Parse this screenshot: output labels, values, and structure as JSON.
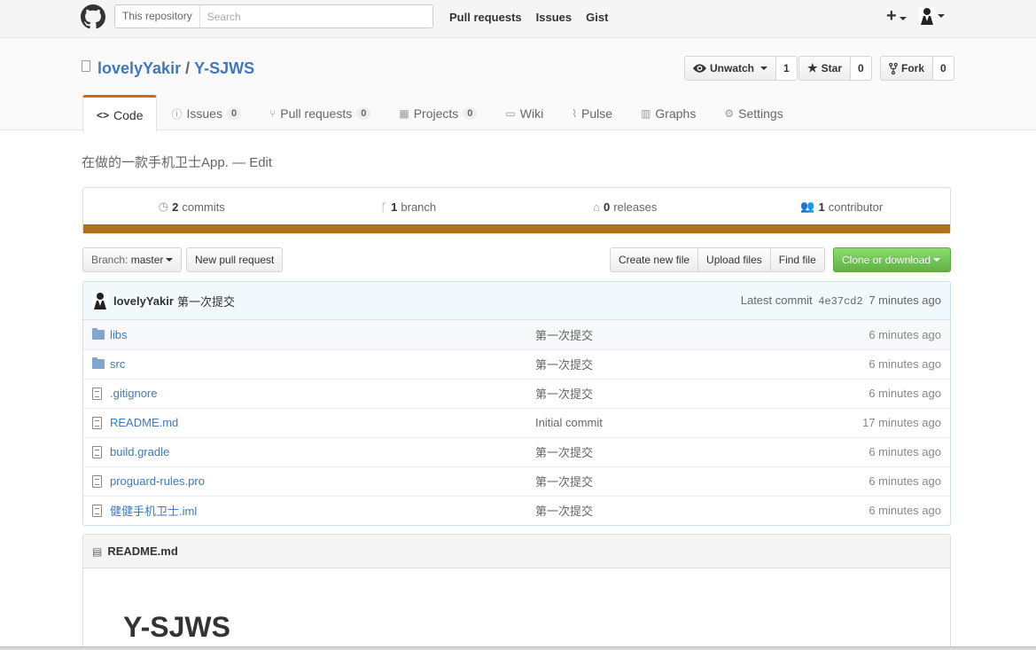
{
  "header": {
    "search_scope": "This repository",
    "search_placeholder": "Search",
    "nav": [
      {
        "label": "Pull requests"
      },
      {
        "label": "Issues"
      },
      {
        "label": "Gist"
      }
    ],
    "plus": "+"
  },
  "repo": {
    "owner": "lovelyYakir",
    "separator": "/",
    "name": "Y-SJWS",
    "watch_label": "Unwatch",
    "watch_count": "1",
    "star_label": "Star",
    "star_count": "0",
    "fork_label": "Fork",
    "fork_count": "0"
  },
  "tabs": [
    {
      "label": "Code",
      "icon": "code-icon"
    },
    {
      "label": "Issues",
      "count": "0",
      "icon": "issue-icon"
    },
    {
      "label": "Pull requests",
      "count": "0",
      "icon": "pull-request-icon"
    },
    {
      "label": "Projects",
      "count": "0",
      "icon": "project-icon"
    },
    {
      "label": "Wiki",
      "icon": "book-icon"
    },
    {
      "label": "Pulse",
      "icon": "pulse-icon"
    },
    {
      "label": "Graphs",
      "icon": "graph-icon"
    },
    {
      "label": "Settings",
      "icon": "gear-icon"
    }
  ],
  "description": {
    "text": "在做的一款手机卫士App.",
    "dash": "—",
    "edit": "Edit"
  },
  "summary": {
    "commits_num": "2",
    "commits_label": "commits",
    "branch_num": "1",
    "branch_label": "branch",
    "releases_num": "0",
    "releases_label": "releases",
    "contributor_num": "1",
    "contributor_label": "contributor",
    "language_color": "#b07219"
  },
  "file_nav": {
    "branch_prefix": "Branch:",
    "branch": "master",
    "new_pr": "New pull request",
    "create_file": "Create new file",
    "upload_files": "Upload files",
    "find_file": "Find file",
    "clone": "Clone or download"
  },
  "commit": {
    "author": "lovelyYakir",
    "message": "第一次提交",
    "latest_label": "Latest commit",
    "sha": "4e37cd2",
    "age": "7 minutes ago"
  },
  "files": [
    {
      "type": "dir",
      "name": "libs",
      "message": "第一次提交",
      "age": "6 minutes ago"
    },
    {
      "type": "dir",
      "name": "src",
      "message": "第一次提交",
      "age": "6 minutes ago"
    },
    {
      "type": "file",
      "name": ".gitignore",
      "message": "第一次提交",
      "age": "6 minutes ago"
    },
    {
      "type": "file",
      "name": "README.md",
      "message": "Initial commit",
      "age": "17 minutes ago"
    },
    {
      "type": "file",
      "name": "build.gradle",
      "message": "第一次提交",
      "age": "6 minutes ago"
    },
    {
      "type": "file",
      "name": "proguard-rules.pro",
      "message": "第一次提交",
      "age": "6 minutes ago"
    },
    {
      "type": "file",
      "name": "健健手机卫士.iml",
      "message": "第一次提交",
      "age": "6 minutes ago"
    }
  ],
  "readme": {
    "filename": "README.md",
    "heading": "Y-SJWS"
  }
}
